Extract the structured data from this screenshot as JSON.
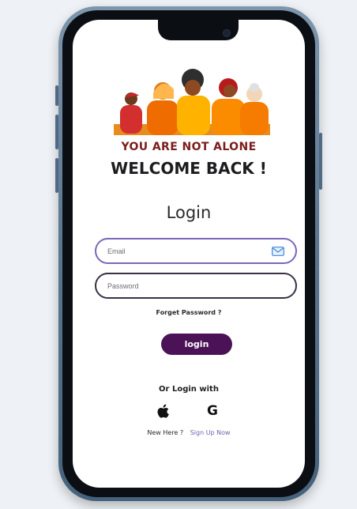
{
  "hero": {
    "illustration_icon": "group-of-people-illustration"
  },
  "header": {
    "tagline": "YOU ARE NOT ALONE",
    "welcome": "WELCOME BACK !",
    "title": "Login"
  },
  "form": {
    "email_placeholder": "Email",
    "email_value": "",
    "email_icon": "mail-icon",
    "password_placeholder": "Password",
    "password_value": "",
    "forgot_label": "Forget Password ?",
    "login_label": "login"
  },
  "social": {
    "heading": "Or Login with",
    "providers": [
      {
        "name": "apple",
        "icon": "apple-icon"
      },
      {
        "name": "google",
        "icon": "google-icon",
        "glyph": "G"
      }
    ]
  },
  "signup": {
    "prompt": "New Here ?",
    "link_label": "Sign Up Now"
  },
  "colors": {
    "accent": "#4b1257",
    "tagline": "#7a1d1d",
    "link": "#7262b2",
    "email_border": "#7b67b8"
  }
}
